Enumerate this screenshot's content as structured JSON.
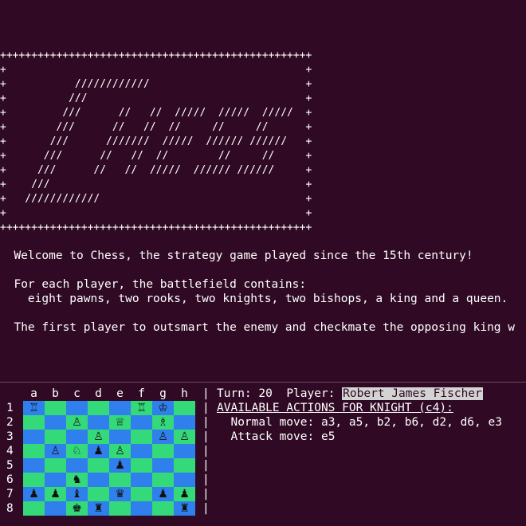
{
  "banner": "++++++++++++++++++++++++++++++++++++++++++++++++++\n+                                                +\n+           ////////////                         +\n+          ///                                   +\n+         ///      //   //  /////  /////  /////  +\n+        ///      //   //  //     //     //      +\n+       ///      ///////  /////  ////// //////   +\n+      ///      //   //  //        //     //     +\n+     ///      //   //  /////  ////// //////     +\n+    ///                                         +\n+   ////////////                                 +\n+                                                +\n++++++++++++++++++++++++++++++++++++++++++++++++++",
  "intro": {
    "welcome": "  Welcome to Chess, the strategy game played since the 15th century!",
    "battlefield": "  For each player, the battlefield contains:",
    "pieces": "    eight pawns, two rooks, two knights, two bishops, a king and a queen.",
    "goal": "  The first player to outsmart the enemy and checkmate the opposing king w"
  },
  "board": {
    "files": [
      "a",
      "b",
      "c",
      "d",
      "e",
      "f",
      "g",
      "h"
    ],
    "ranks": [
      "1",
      "2",
      "3",
      "4",
      "5",
      "6",
      "7",
      "8"
    ],
    "rows": [
      [
        "♖",
        "",
        "",
        "",
        "",
        "♖",
        "♔",
        ""
      ],
      [
        "",
        "",
        "♙",
        "",
        "♕",
        "",
        "♗",
        ""
      ],
      [
        "",
        "",
        "",
        "♙",
        "",
        "",
        "♙",
        "♙"
      ],
      [
        "",
        "♙",
        "♘",
        "♟",
        "♙",
        "",
        "",
        ""
      ],
      [
        "",
        "",
        "",
        "",
        "♟",
        "",
        "",
        ""
      ],
      [
        "",
        "",
        "♞",
        "",
        "",
        "",
        "",
        ""
      ],
      [
        "♟",
        "♟",
        "♝",
        "",
        "♛",
        "",
        "♟",
        "♟"
      ],
      [
        "",
        "",
        "♚",
        "♜",
        "",
        "",
        "",
        "♜"
      ]
    ],
    "colors": {
      "light": "#34d97a",
      "dark": "#2f80ed"
    }
  },
  "status": {
    "turn_label": "Turn:",
    "turn": "20",
    "player_label": "Player:",
    "player": "Robert James Fischer",
    "actions_title": "AVAILABLE ACTIONS FOR KNIGHT (c4):",
    "normal_label": "Normal move:",
    "normal_moves": "a3, a5, b2, b6, d2, d6, e3",
    "attack_label": "Attack move:",
    "attack_moves": "e5"
  },
  "pipe": "|"
}
